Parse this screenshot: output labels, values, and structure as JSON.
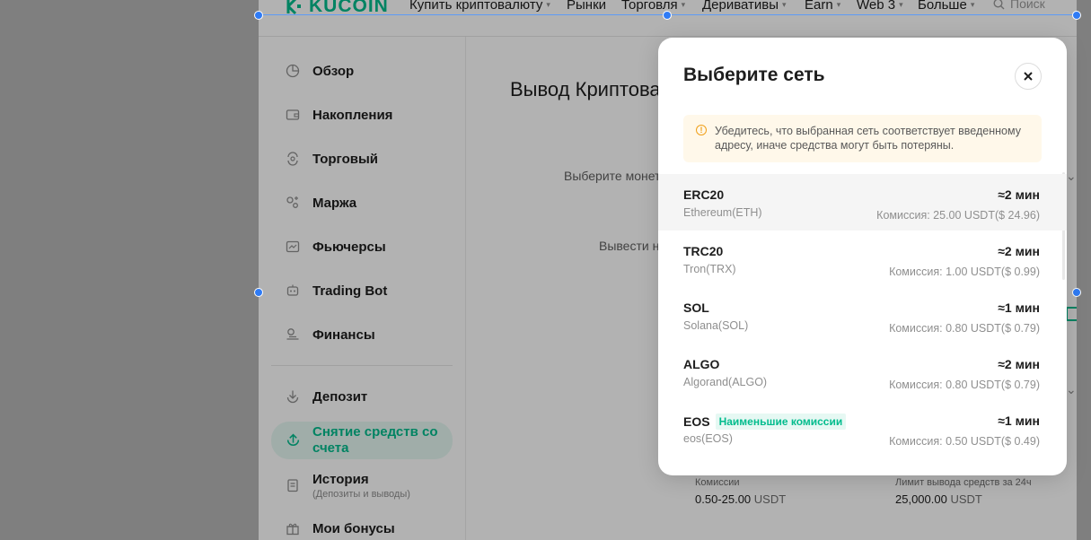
{
  "nav": {
    "logo": "KUCOIN",
    "items": [
      {
        "label": "Купить криптовалюту",
        "caret": "▾"
      },
      {
        "label": "Рынки",
        "caret": ""
      },
      {
        "label": "Торговля",
        "caret": "▾"
      },
      {
        "label": "Деривативы",
        "caret": "▾"
      },
      {
        "label": "Earn",
        "caret": "▾"
      },
      {
        "label": "Web 3",
        "caret": "▾"
      },
      {
        "label": "Больше",
        "caret": "▾"
      }
    ],
    "search_placeholder": "Поиск"
  },
  "sidebar": {
    "items": [
      {
        "label": "Обзор",
        "icon": "pie-chart-icon"
      },
      {
        "label": "Накопления",
        "icon": "wallet-icon"
      },
      {
        "label": "Торговый",
        "icon": "exchange-icon"
      },
      {
        "label": "Маржа",
        "icon": "margin-icon"
      },
      {
        "label": "Фьючерсы",
        "icon": "futures-icon"
      },
      {
        "label": "Trading Bot",
        "icon": "bot-icon"
      },
      {
        "label": "Финансы",
        "icon": "finance-icon"
      },
      {
        "label": "Депозит",
        "icon": "deposit-icon"
      },
      {
        "label": "Снятие средств со счета",
        "icon": "withdraw-icon",
        "active": true
      },
      {
        "label": "История",
        "sub": "(Депозиты и выводы)",
        "icon": "history-icon"
      },
      {
        "label": "Мои бонусы",
        "icon": "gift-icon"
      }
    ]
  },
  "main": {
    "title": "Вывод Криптова",
    "select_coin_label": "Выберите монет",
    "withdraw_to_label": "Вывести н",
    "fees_label": "Комиссии",
    "fees_value": "0.50-25.00",
    "fees_unit": "USDT",
    "limit_label": "Лимит вывода средств за 24ч",
    "limit_value": "25,000.00",
    "limit_unit": "USDT"
  },
  "modal": {
    "title": "Выберите сеть",
    "warning": "Убедитесь, что выбранная сеть соответствует введенному адресу, иначе средства могут быть потеряны.",
    "networks": [
      {
        "name": "ERC20",
        "chain": "Ethereum(ETH)",
        "time": "≈2 мин",
        "fee": "Комиссия: 25.00 USDT($ 24.96)",
        "badge": ""
      },
      {
        "name": "TRC20",
        "chain": "Tron(TRX)",
        "time": "≈2 мин",
        "fee": "Комиссия: 1.00 USDT($ 0.99)",
        "badge": ""
      },
      {
        "name": "SOL",
        "chain": "Solana(SOL)",
        "time": "≈1 мин",
        "fee": "Комиссия: 0.80 USDT($ 0.79)",
        "badge": ""
      },
      {
        "name": "ALGO",
        "chain": "Algorand(ALGO)",
        "time": "≈2 мин",
        "fee": "Комиссия: 0.80 USDT($ 0.79)",
        "badge": ""
      },
      {
        "name": "EOS",
        "chain": "eos(EOS)",
        "time": "≈1 мин",
        "fee": "Комиссия: 0.50 USDT($ 0.49)",
        "badge": "Наименьшие комиссии"
      }
    ]
  },
  "colors": {
    "accent": "#01bc8d",
    "warning": "#f0a01a",
    "selection": "#2f7bf5"
  }
}
